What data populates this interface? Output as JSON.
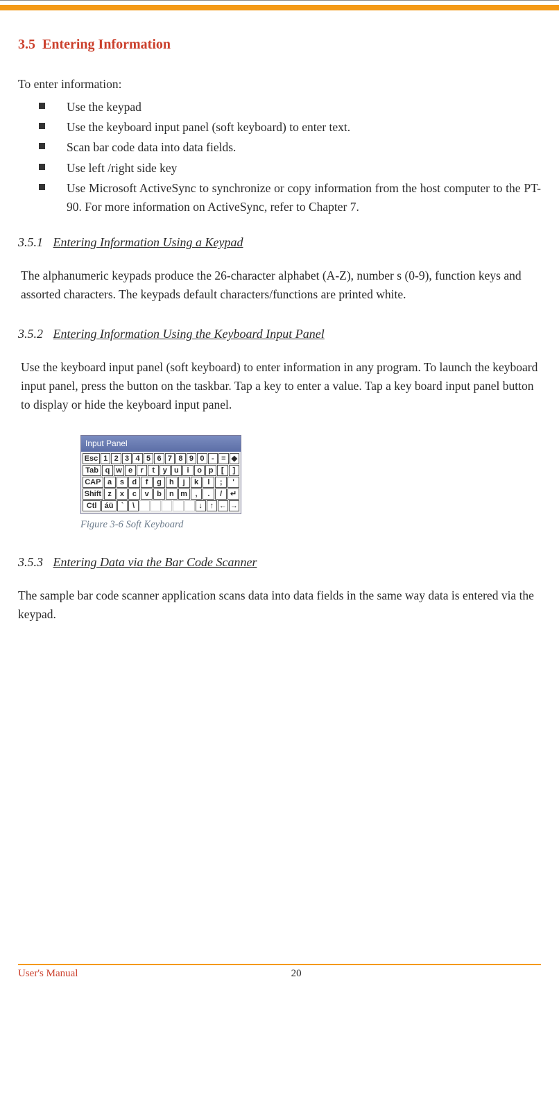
{
  "header": {
    "section_num": "3.5",
    "section_title": "Entering Information"
  },
  "intro": "To enter information:",
  "bullets": [
    "Use the keypad",
    "Use the keyboard input panel (soft keyboard) to enter text.",
    "Scan bar code data into data fields.",
    "Use left /right side key",
    "Use Microsoft ActiveSync to synchronize or copy information from the host computer to the PT-90. For more information on ActiveSync, refer to Chapter 7."
  ],
  "s1": {
    "num": "3.5.1",
    "title": "Entering Information Using a Keypad",
    "body": "The alphanumeric keypads produce the 26-character alphabet (A-Z), number s (0-9), function keys and assorted characters. The keypads default characters/functions are printed white."
  },
  "s2": {
    "num": "3.5.2",
    "title": "Entering Information Using the Keyboard Input Panel",
    "body": "Use the keyboard input panel (soft keyboard) to enter information in any program. To launch the keyboard input panel, press the button on the taskbar. Tap a key to enter a value. Tap a key board input panel button to display or hide the keyboard input panel."
  },
  "keyboard": {
    "title": "Input Panel",
    "rows": [
      [
        "Esc",
        "1",
        "2",
        "3",
        "4",
        "5",
        "6",
        "7",
        "8",
        "9",
        "0",
        "-",
        "=",
        "◆"
      ],
      [
        "Tab",
        "q",
        "w",
        "e",
        "r",
        "t",
        "y",
        "u",
        "i",
        "o",
        "p",
        "[",
        "]"
      ],
      [
        "CAP",
        "a",
        "s",
        "d",
        "f",
        "g",
        "h",
        "j",
        "k",
        "l",
        ";",
        "'"
      ],
      [
        "Shift",
        "z",
        "x",
        "c",
        "v",
        "b",
        "n",
        "m",
        ",",
        ".",
        "/",
        "↵"
      ],
      [
        "Ctl",
        "áü",
        "`",
        "\\",
        "",
        "",
        "",
        "",
        "",
        "↓",
        "↑",
        "←",
        "→"
      ]
    ],
    "caption": "Figure 3-6 Soft Keyboard"
  },
  "s3": {
    "num": "3.5.3",
    "title": "Entering Data via the Bar Code Scanner",
    "body": "The sample bar code scanner application scans data into data fields in the same way data is entered via the keypad."
  },
  "footer": {
    "left": "User's Manual",
    "page": "20"
  }
}
